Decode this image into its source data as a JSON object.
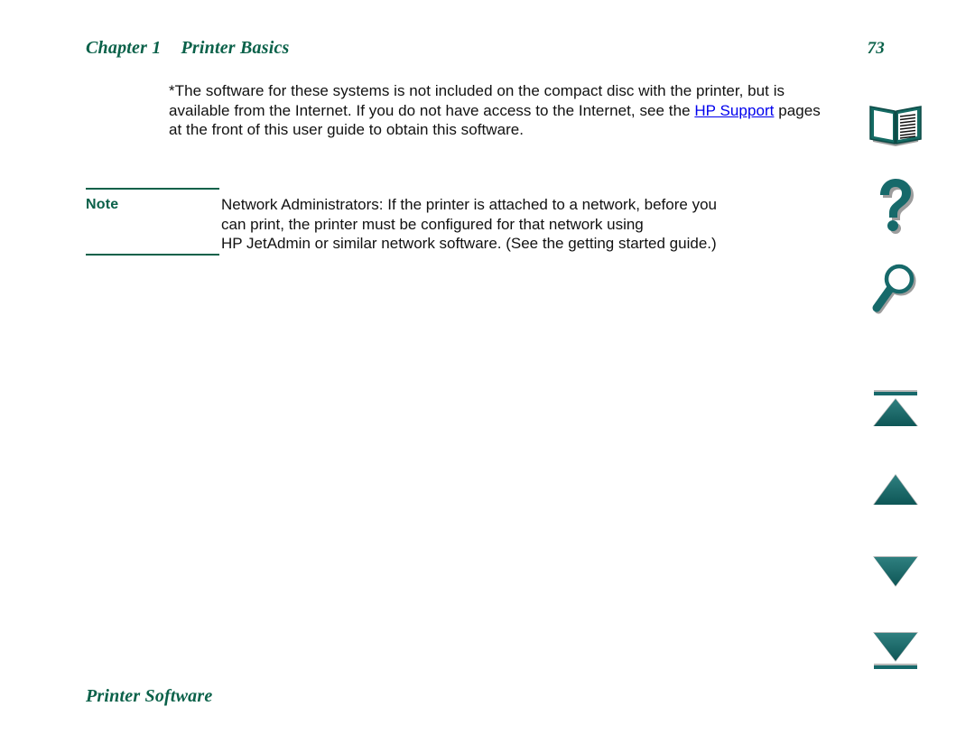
{
  "header": {
    "chapter": "Chapter 1",
    "title": "Printer Basics",
    "page_number": "73"
  },
  "body": {
    "paragraph_1_part_1": "*The software for these systems is not included on the compact disc with the printer, but is available from the Internet. If you do not have access to the Internet, see the ",
    "link_label": "HP Support",
    "paragraph_1_part_2": " pages at the front of this user guide to obtain this software."
  },
  "note": {
    "label": "Note",
    "line_1": "Network Administrators: If the printer is attached to a network, before you",
    "line_2": "can print, the printer must be configured for that network using",
    "line_3": "HP JetAdmin or similar network software. (See the getting started guide.)"
  },
  "footer": {
    "section": "Printer Software"
  },
  "nav_rail": {
    "items": [
      {
        "name": "book-icon",
        "tooltip": "Contents"
      },
      {
        "name": "question-mark-icon",
        "tooltip": "Help"
      },
      {
        "name": "magnifier-icon",
        "tooltip": "Search"
      },
      {
        "name": "first-page-icon",
        "tooltip": "First page"
      },
      {
        "name": "previous-page-icon",
        "tooltip": "Previous page"
      },
      {
        "name": "next-page-icon",
        "tooltip": "Next page"
      },
      {
        "name": "last-page-icon",
        "tooltip": "Last page"
      }
    ]
  },
  "colors": {
    "heading_green": "#0a6149",
    "icon_teal": "#1b6b6b",
    "icon_teal_dark": "#0d4f50",
    "link_blue": "#0000ee",
    "page_background": "#ffffff",
    "shadow_gray": "#9a9a9a"
  }
}
